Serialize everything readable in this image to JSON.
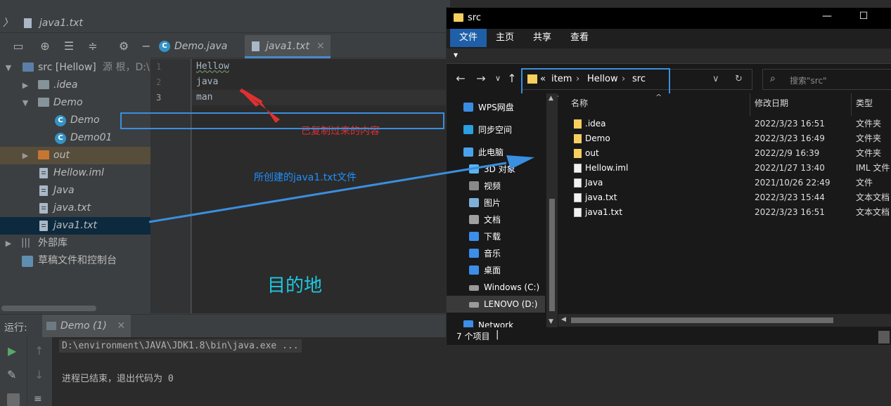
{
  "ide": {
    "breadcrumb": "java1.txt",
    "project_tree": [
      {
        "label": "src [Hellow]",
        "suffix": "源 根，D:\\",
        "kind": "root"
      },
      {
        "label": ".idea",
        "kind": "folder"
      },
      {
        "label": "Demo",
        "kind": "folder"
      },
      {
        "label": "Demo",
        "kind": "class"
      },
      {
        "label": "Demo01",
        "kind": "class"
      },
      {
        "label": "out",
        "kind": "folder-orange"
      },
      {
        "label": "Hellow.iml",
        "kind": "file"
      },
      {
        "label": "Java",
        "kind": "file"
      },
      {
        "label": "java.txt",
        "kind": "file"
      },
      {
        "label": "java1.txt",
        "kind": "file"
      },
      {
        "label": "外部库",
        "kind": "lib"
      },
      {
        "label": "草稿文件和控制台",
        "kind": "scratch"
      }
    ],
    "editor_tabs": [
      {
        "label": "Demo.java"
      },
      {
        "label": "java1.txt"
      }
    ],
    "line_numbers": [
      "1",
      "2",
      "3"
    ],
    "code_lines": [
      "Hellow",
      "java",
      "man"
    ],
    "run": {
      "label": "运行:",
      "tab": "Demo (1)",
      "command": "D:\\environment\\JAVA\\JDK1.8\\bin\\java.exe ...",
      "exit": "进程已结束，退出代码为 0"
    }
  },
  "annotations": {
    "copied": "已复制过来的内容",
    "created": "所创建的java1.txt文件",
    "destination": "目的地"
  },
  "explorer": {
    "title": "src",
    "ribbon_tabs": [
      "文件",
      "主页",
      "共享",
      "查看"
    ],
    "path": [
      "item",
      "Hellow",
      "src"
    ],
    "path_prefix": "«",
    "search_placeholder": "搜索\"src\"",
    "nav_items": [
      {
        "label": "WPS网盘",
        "color": "#3b8be0"
      },
      {
        "label": "同步空间",
        "color": "#2aa0e0"
      },
      {
        "label": "此电脑",
        "color": "#4aa3ea"
      },
      {
        "label": "3D 对象",
        "color": "#5ab4f0"
      },
      {
        "label": "视频",
        "color": "#8a8a8a"
      },
      {
        "label": "图片",
        "color": "#7fb0d8"
      },
      {
        "label": "文档",
        "color": "#a0a0a0"
      },
      {
        "label": "下载",
        "color": "#3c8ee8"
      },
      {
        "label": "音乐",
        "color": "#3c8ee8"
      },
      {
        "label": "桌面",
        "color": "#3c8ee8"
      },
      {
        "label": "Windows (C:)",
        "color": "#9a9a9a"
      },
      {
        "label": "LENOVO (D:)",
        "color": "#9a9a9a"
      },
      {
        "label": "Network",
        "color": "#3c8ee8"
      }
    ],
    "columns": [
      "名称",
      "修改日期",
      "类型"
    ],
    "files": [
      {
        "name": ".idea",
        "date": "2022/3/23 16:51",
        "type": "文件夹",
        "dir": true
      },
      {
        "name": "Demo",
        "date": "2022/3/23 16:49",
        "type": "文件夹",
        "dir": true
      },
      {
        "name": "out",
        "date": "2022/2/9 16:39",
        "type": "文件夹",
        "dir": true
      },
      {
        "name": "Hellow.iml",
        "date": "2022/1/27 13:40",
        "type": "IML 文件",
        "dir": false
      },
      {
        "name": "Java",
        "date": "2021/10/26 22:49",
        "type": "文件",
        "dir": false
      },
      {
        "name": "java.txt",
        "date": "2022/3/23 15:44",
        "type": "文本文档",
        "dir": false
      },
      {
        "name": "java1.txt",
        "date": "2022/3/23 16:51",
        "type": "文本文档",
        "dir": false
      }
    ],
    "status": "7 个项目"
  }
}
